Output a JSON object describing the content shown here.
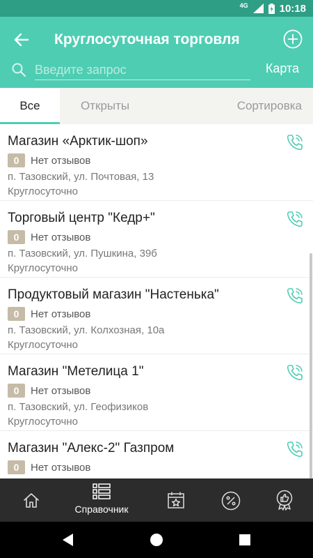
{
  "status": {
    "network": "4G",
    "time": "10:18"
  },
  "header": {
    "title": "Круглосуточная торговля",
    "search_placeholder": "Введите запрос",
    "map_label": "Карта"
  },
  "tabs": [
    {
      "label": "Все",
      "active": true
    },
    {
      "label": "Открыты",
      "active": false
    },
    {
      "label": "Сортировка",
      "active": false
    }
  ],
  "items": [
    {
      "title": "Магазин «Арктик-шоп»",
      "rating": "0",
      "reviews": "Нет отзывов",
      "address": "п. Тазовский, ул. Почтовая, 13",
      "hours": "Круглосуточно"
    },
    {
      "title": "Торговый центр \"Кедр+\"",
      "rating": "0",
      "reviews": "Нет отзывов",
      "address": "п. Тазовский, ул. Пушкина, 39б",
      "hours": "Круглосуточно"
    },
    {
      "title": "Продуктовый магазин \"Настенька\"",
      "rating": "0",
      "reviews": "Нет отзывов",
      "address": "п. Тазовский, ул. Колхозная, 10а",
      "hours": "Круглосуточно"
    },
    {
      "title": "Магазин \"Метелица 1\"",
      "rating": "0",
      "reviews": "Нет отзывов",
      "address": "п. Тазовский, ул. Геофизиков",
      "hours": "Круглосуточно"
    },
    {
      "title": "Магазин \"Алекс-2\" Газпром",
      "rating": "0",
      "reviews": "Нет отзывов",
      "address": "",
      "hours": ""
    }
  ],
  "bottom_nav": [
    {
      "icon": "home-icon",
      "label": ""
    },
    {
      "icon": "directory-list-icon",
      "label": "Справочник"
    },
    {
      "icon": "calendar-star-icon",
      "label": ""
    },
    {
      "icon": "percent-icon",
      "label": ""
    },
    {
      "icon": "award-thumb-icon",
      "label": ""
    }
  ],
  "colors": {
    "primary": "#4ecdb3",
    "status_bar": "#2e9e85",
    "badge": "#c5bba7",
    "nav_bg": "#2c2c2c"
  }
}
